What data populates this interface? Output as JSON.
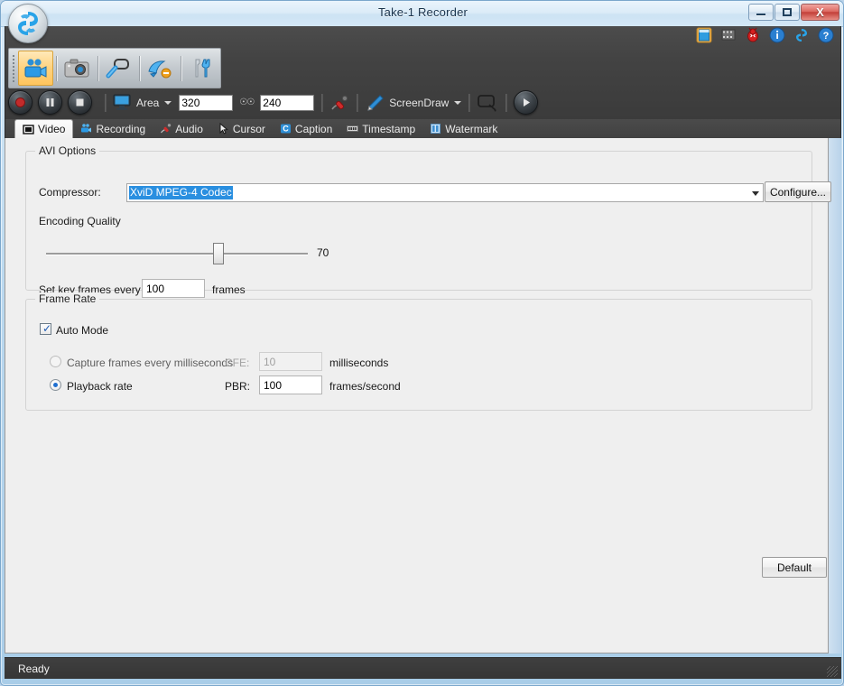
{
  "window": {
    "title": "Take-1 Recorder",
    "controls": {
      "minimize": "minimize-button",
      "maximize": "maximize-button",
      "close": "X"
    }
  },
  "header_icons": [
    {
      "name": "save-icon",
      "label": "Save"
    },
    {
      "name": "film-strip-icon",
      "label": "Film"
    },
    {
      "name": "bug-icon",
      "label": "Bug"
    },
    {
      "name": "info-icon",
      "label": "Info"
    },
    {
      "name": "brand-icon",
      "label": "Brand"
    },
    {
      "name": "help-icon",
      "label": "Help"
    }
  ],
  "mode_toolbar": [
    {
      "name": "video-recorder-mode",
      "label": "Video Recorder",
      "selected": true
    },
    {
      "name": "screen-capture-mode",
      "label": "Screen Capture",
      "selected": false
    },
    {
      "name": "zoom-mode",
      "label": "Zoom",
      "selected": false
    },
    {
      "name": "paint-mode",
      "label": "Paint",
      "selected": false
    },
    {
      "name": "tools-mode",
      "label": "Tools",
      "selected": false
    }
  ],
  "control_bar": {
    "record_label": "Record",
    "pause_label": "Pause",
    "stop_label": "Stop",
    "area_label": "Area",
    "width_value": "320",
    "height_value": "240",
    "link_icon": "chain-link-icon",
    "mic_label": "Microphone",
    "screendraw_label": "ScreenDraw",
    "region_label": "Select Region",
    "play_label": "Play"
  },
  "tabs": [
    {
      "label": "Video",
      "icon": "video-tab-icon",
      "active": true
    },
    {
      "label": "Recording",
      "icon": "recording-tab-icon",
      "active": false
    },
    {
      "label": "Audio",
      "icon": "audio-tab-icon",
      "active": false
    },
    {
      "label": "Cursor",
      "icon": "cursor-tab-icon",
      "active": false
    },
    {
      "label": "Caption",
      "icon": "caption-tab-icon",
      "active": false
    },
    {
      "label": "Timestamp",
      "icon": "timestamp-tab-icon",
      "active": false
    },
    {
      "label": "Watermark",
      "icon": "watermark-tab-icon",
      "active": false
    }
  ],
  "avi_options": {
    "group_title": "AVI Options",
    "compressor_label": "Compressor:",
    "compressor_value": "XviD MPEG-4 Codec",
    "configure_label": "Configure...",
    "encoding_quality_label": "Encoding Quality",
    "encoding_quality_value": "70",
    "keyframe_label": "Set key frames every",
    "keyframe_value": "100",
    "keyframe_suffix": "frames"
  },
  "frame_rate": {
    "group_title": "Frame Rate",
    "auto_mode_label": "Auto Mode",
    "auto_mode_checked": true,
    "capture_label": "Capture frames every milliseconds",
    "capture_selected": false,
    "cfe_label": "CFE:",
    "cfe_value": "10",
    "cfe_suffix": "milliseconds",
    "playback_label": "Playback rate",
    "playback_selected": true,
    "pbr_label": "PBR:",
    "pbr_value": "100",
    "pbr_suffix": "frames/second"
  },
  "default_button_label": "Default",
  "status_bar": {
    "text": "Ready"
  },
  "colors": {
    "accent_blue": "#2a8fe0",
    "chrome_dark": "#434343",
    "panel_bg": "#efefef",
    "selection_blue": "#2a8fe0",
    "close_red": "#c33f38",
    "tab_active_bg": "#f5f5f5"
  }
}
